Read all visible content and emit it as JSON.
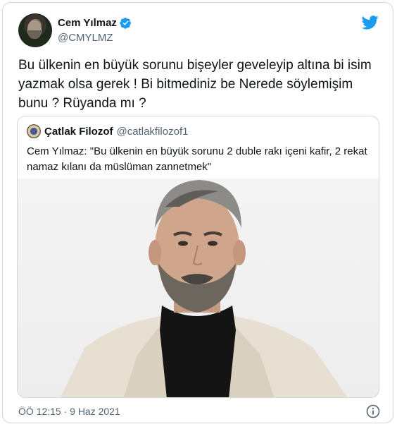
{
  "author": {
    "name": "Cem Yılmaz",
    "handle": "@CMYLMZ"
  },
  "tweet": {
    "text": "Bu ülkenin en büyük sorunu bişeyler geveleyip altına bi isim yazmak olsa gerek ! Bi bitmediniz be Nerede söylemişim bunu ? Rüyanda mı ?",
    "timestamp": "ÖÖ 12:15 · 9 Haz 2021"
  },
  "quoted": {
    "name": "Çatlak Filozof",
    "handle": "@catlakfilozof1",
    "text": "Cem Yılmaz: \"Bu ülkenin en büyük sorunu 2 duble rakı içeni kafir, 2 rekat namaz kılanı da müslüman zannetmek\""
  },
  "colors": {
    "twitter_blue": "#1d9bf0",
    "text_primary": "#0f1419",
    "text_secondary": "#536471",
    "border": "#cfd9de"
  },
  "icons": {
    "verified": "verified-badge-icon",
    "brand": "twitter-bird-icon",
    "info": "info-icon"
  }
}
